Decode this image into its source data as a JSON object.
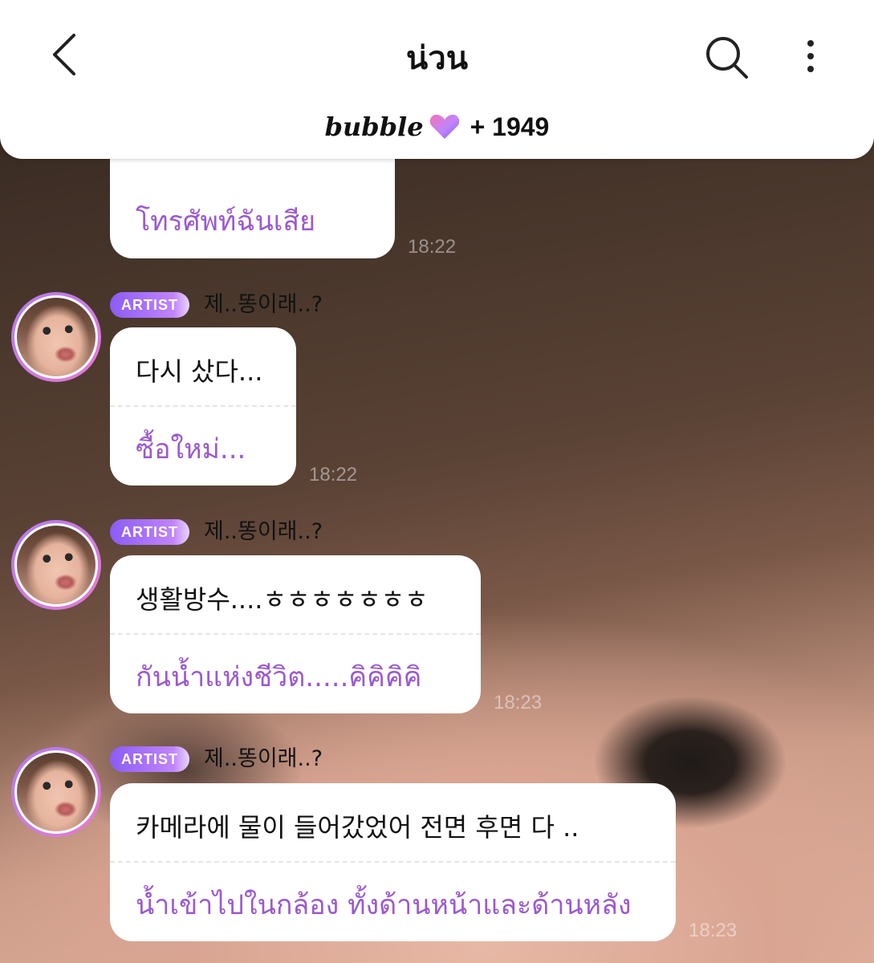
{
  "header": {
    "title": "น่วน",
    "brand_logo": "bubble",
    "brand_count": "+ 1949"
  },
  "messages": [
    {
      "partial": true,
      "translation": "โทรศัพท์ฉันเสีย",
      "time": "18:22"
    },
    {
      "badge": "ARTIST",
      "sender": "제..똥이래..?",
      "original": "다시 샀다...",
      "translation": "ซื้อใหม่...",
      "time": "18:22"
    },
    {
      "badge": "ARTIST",
      "sender": "제..똥이래..?",
      "original": "생활방수....ㅎㅎㅎㅎㅎㅎㅎ",
      "translation": "กันน้ำแห่งชีวิต.....คิคิคิคิ",
      "time": "18:23"
    },
    {
      "badge": "ARTIST",
      "sender": "제..똥이래..?",
      "original": "카메라에 물이 들어갔었어 전면 후면 다 ..",
      "translation": "น้ำเข้าไปในกล้อง ทั้งด้านหน้าและด้านหลัง",
      "time": "18:23"
    }
  ],
  "colors": {
    "translation_text": "#9b59d0",
    "badge_gradient_start": "#8b5cf6",
    "badge_gradient_end": "#c084fc"
  }
}
